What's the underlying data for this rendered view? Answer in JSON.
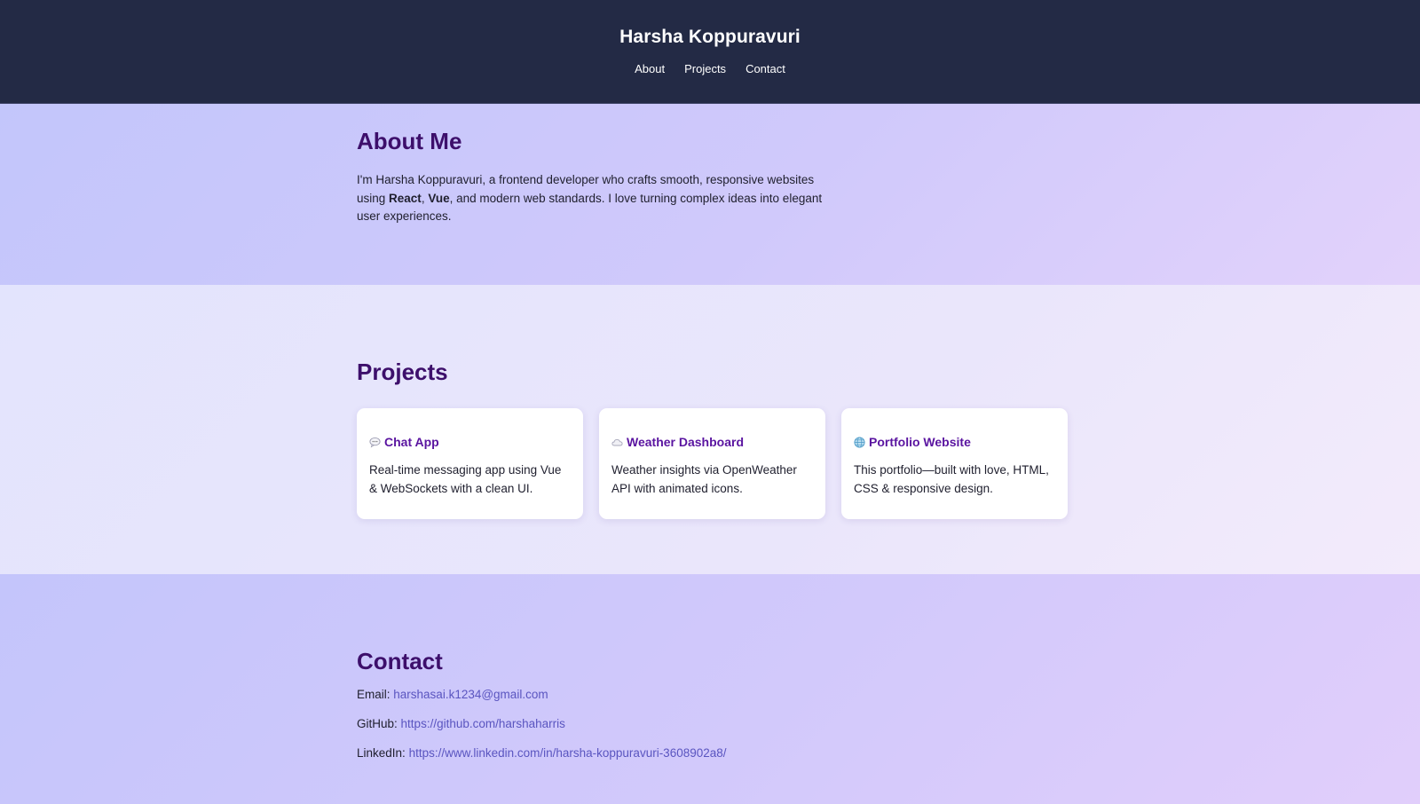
{
  "header": {
    "title": "Harsha Koppuravuri",
    "nav": [
      "About",
      "Projects",
      "Contact"
    ]
  },
  "about": {
    "heading": "About Me",
    "text_1": "I'm Harsha Koppuravuri, a frontend developer who crafts smooth, responsive websites using ",
    "bold_1": "React",
    "text_2": ", ",
    "bold_2": "Vue",
    "text_3": ", and modern web standards. I love turning complex ideas into elegant user experiences."
  },
  "projects": {
    "heading": "Projects",
    "cards": [
      {
        "icon": "speech-bubble-icon",
        "title": "Chat App",
        "description": "Real-time messaging app using Vue & WebSockets with a clean UI."
      },
      {
        "icon": "cloud-icon",
        "title": "Weather Dashboard",
        "description": "Weather insights via OpenWeather API with animated icons."
      },
      {
        "icon": "globe-icon",
        "title": "Portfolio Website",
        "description": "This portfolio—built with love, HTML, CSS & responsive design."
      }
    ]
  },
  "contact": {
    "heading": "Contact",
    "email_label": "Email:",
    "email_value": "harshasai.k1234@gmail.com",
    "github_label": "GitHub:",
    "github_value": "https://github.com/harshaharris",
    "linkedin_label": "LinkedIn:",
    "linkedin_value": "https://www.linkedin.com/in/harsha-koppuravuri-3608902a8/"
  },
  "colors": {
    "header_bg": "#232a45",
    "heading": "#3d0f6b",
    "card_title": "#5a14a0",
    "link": "#5a55c0"
  }
}
